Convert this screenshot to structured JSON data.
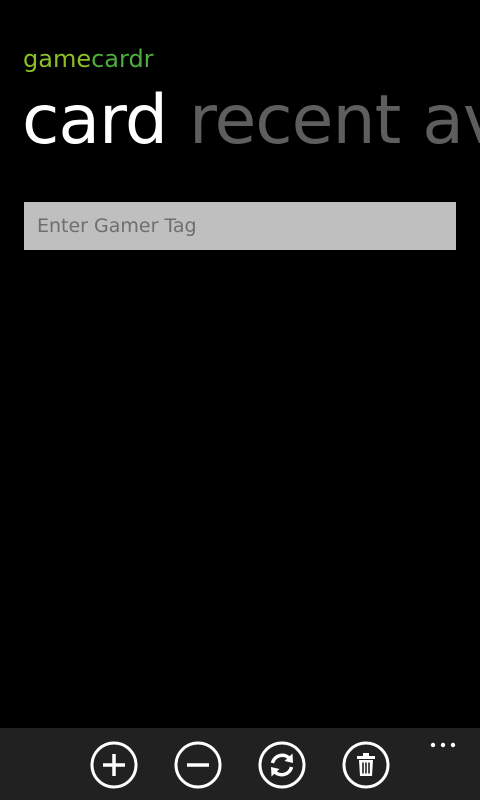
{
  "app": {
    "title_part1": "game",
    "title_part2": "cardr",
    "title_colors": [
      "#8cbf26",
      "#4cae3c"
    ]
  },
  "pivot": {
    "items": [
      {
        "label": "card",
        "active": true
      },
      {
        "label": "recent",
        "active": false
      },
      {
        "label": "ava",
        "active": false
      }
    ]
  },
  "gamertag": {
    "placeholder": "Enter Gamer Tag",
    "value": ""
  },
  "app_bar": {
    "buttons": [
      {
        "icon": "add-icon"
      },
      {
        "icon": "remove-icon"
      },
      {
        "icon": "refresh-icon"
      },
      {
        "icon": "delete-icon"
      }
    ],
    "more_icon": "more-icon"
  }
}
